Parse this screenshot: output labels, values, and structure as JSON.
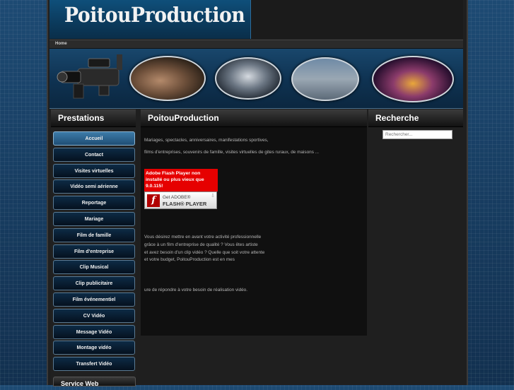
{
  "site": {
    "logo": "PoitouProduction"
  },
  "nav": {
    "home": "Home"
  },
  "left_box": {
    "title": "Prestations",
    "items": [
      "Accueil",
      "Contact",
      "Visites virtuelles",
      "Vidéo semi aérienne",
      "Reportage",
      "Mariage",
      "Film de famille",
      "Film d'entreprise",
      "Clip Musical",
      "Clip publicitaire",
      "Film événementiel",
      "CV Vidéo",
      "Message Vidéo",
      "Montage vidéo",
      "Transfert Vidéo"
    ],
    "active_index": 0,
    "next_box_title": "Service Web"
  },
  "content": {
    "title": "PoitouProduction",
    "line1": "Mariages, spectacles, anniversaires, manifestations sportives,",
    "line2": "films d'entreprises, souvenirs de famille, visites virtuelles de gites ruraux, de maisons ...",
    "flash_warning": "Adobe Flash Player non installé ou plus vieux que 9.0.115!",
    "flash_get": "Get ADOBE®",
    "flash_player": "FLASH® PLAYER",
    "para_lines": [
      "Vous désirez mettre  en avant votre  activité  professionnelle",
      "grâce  à un film d'entreprise de qualité ? Vous êtes artiste",
      "et avez  besoin  d'un clip vidéo ?  Quelle que soit votre attente",
      "et  votre  budget,  PoitouProduction  est en  mes"
    ],
    "last_line": "ure de répondre à votre besoin de réalisation vidéo."
  },
  "right_box": {
    "title": "Recherche",
    "search_placeholder": "Rechercher..."
  },
  "colors": {
    "accent": "#3d7ba8",
    "flash_red": "#e60000"
  }
}
